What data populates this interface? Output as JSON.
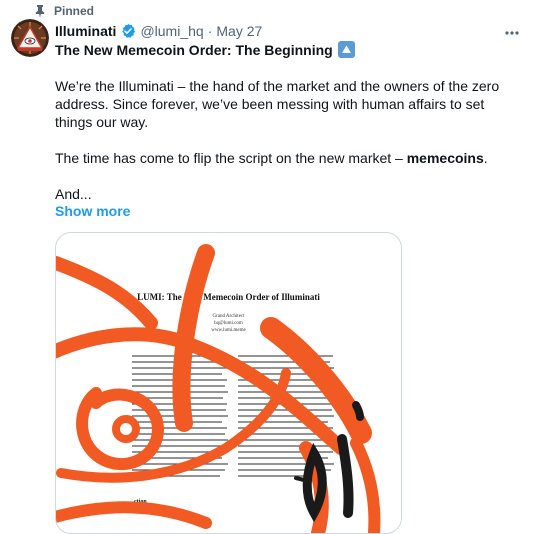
{
  "pinned_label": "Pinned",
  "author": {
    "name": "Illuminati",
    "handle": "@lumi_hq",
    "separator": "·",
    "date": "May 27"
  },
  "title": "The New Memecoin Order: The Beginning",
  "paragraphs": {
    "p1": "We’re the Illuminati – the hand of the market and the owners of the zero address. Since forever, we’ve been messing with human affairs to set things our way.",
    "p2_prefix": "The time has come to flip the script on the new market – ",
    "p2_bold": "memecoins",
    "p2_suffix": ".",
    "p3": "And..."
  },
  "show_more": "Show more",
  "media": {
    "doc_title": "LUMI: The New Memecoin Order of Illuminati",
    "doc_author": "Grand Architect",
    "doc_email": "hq@lumi.com",
    "doc_site": "www.lumi.meme",
    "doc_intro": "ction"
  },
  "colors": {
    "accent": "#1d9bf0",
    "verified": "#1d9bf0",
    "muted": "#536471",
    "paint": "#f15a22"
  },
  "icons": {
    "pin": "pin-icon",
    "verified": "verified-badge-icon",
    "more": "more-dots-icon",
    "title_emoji": "up-arrow-emoji-icon"
  }
}
